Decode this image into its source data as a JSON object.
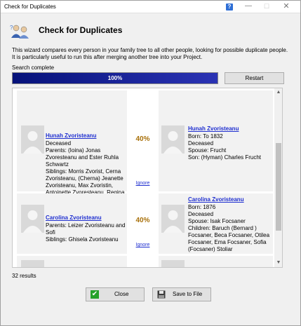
{
  "window": {
    "title": "Check for Duplicates",
    "help_label": "?"
  },
  "header": {
    "title": "Check for Duplicates",
    "description": "This wizard compares every person in your family tree to all other people, looking for possible duplicate people. It is particularly useful to run this after merging another tree into your Project."
  },
  "status": {
    "text": "Search complete",
    "progress_label": "100%",
    "progress_value": 1.0,
    "restart_label": "Restart"
  },
  "matches": [
    {
      "percent": "40%",
      "ignore_label": "Ignore",
      "left": {
        "name": "Hunah Zvoristeanu",
        "details": [
          "Deceased",
          "Parents: (Ioina) Jonas",
          "Zvoresteanu and Ester Ruhla",
          "Schwartz",
          "Siblings: Morris Zvorist, Cerna",
          "Zvoristeanu, (Cherna) Jeanette",
          "Zvoristeanu, Max Zvoristin,",
          "Antoinette Zvoresteanu, Regina"
        ]
      },
      "right": {
        "name": "Hunah Zvoristeanu",
        "details": [
          "Born: To 1832",
          "Deceased",
          "Spouse: Frucht",
          "Son: (Hyman) Charles Frucht"
        ]
      }
    },
    {
      "percent": "40%",
      "ignore_label": "Ignore",
      "left": {
        "name": "Carolina Zvoristeanu",
        "details": [
          "Parents: Leizer Zvoristeanu and",
          "Sofi",
          "Siblings: Ghisela Zvoristeanu"
        ]
      },
      "right": {
        "name": "Carolina Zvoristeanu",
        "details": [
          "Born: 1876",
          "Deceased",
          "Spouse: Isak Focsaner",
          "Children: Baruch (Bernard )",
          "Focsaner, Beca Focsaner, Otilea",
          "Focsaner, Ema Focsaner, Sofia",
          "(Focsaner) Stoliar"
        ]
      }
    }
  ],
  "footer": {
    "result_count": "32 results",
    "close_label": "Close",
    "save_label": "Save to File"
  },
  "colors": {
    "progress": "#06127a",
    "link": "#1f2fd0",
    "percent": "#a8700a",
    "check": "#26a12a"
  },
  "icons": [
    "people-icon",
    "silhouette-icon",
    "check-icon",
    "floppy-disk-icon",
    "help-icon"
  ]
}
